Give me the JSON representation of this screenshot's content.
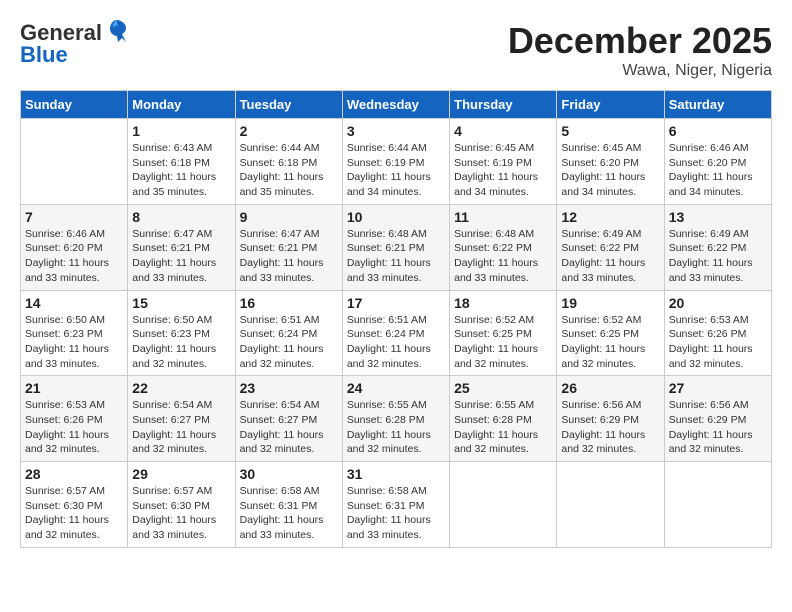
{
  "logo": {
    "general": "General",
    "blue": "Blue"
  },
  "title": "December 2025",
  "location": "Wawa, Niger, Nigeria",
  "days_of_week": [
    "Sunday",
    "Monday",
    "Tuesday",
    "Wednesday",
    "Thursday",
    "Friday",
    "Saturday"
  ],
  "weeks": [
    [
      {
        "num": "",
        "sunrise": "",
        "sunset": "",
        "daylight": ""
      },
      {
        "num": "1",
        "sunrise": "Sunrise: 6:43 AM",
        "sunset": "Sunset: 6:18 PM",
        "daylight": "Daylight: 11 hours and 35 minutes."
      },
      {
        "num": "2",
        "sunrise": "Sunrise: 6:44 AM",
        "sunset": "Sunset: 6:18 PM",
        "daylight": "Daylight: 11 hours and 35 minutes."
      },
      {
        "num": "3",
        "sunrise": "Sunrise: 6:44 AM",
        "sunset": "Sunset: 6:19 PM",
        "daylight": "Daylight: 11 hours and 34 minutes."
      },
      {
        "num": "4",
        "sunrise": "Sunrise: 6:45 AM",
        "sunset": "Sunset: 6:19 PM",
        "daylight": "Daylight: 11 hours and 34 minutes."
      },
      {
        "num": "5",
        "sunrise": "Sunrise: 6:45 AM",
        "sunset": "Sunset: 6:20 PM",
        "daylight": "Daylight: 11 hours and 34 minutes."
      },
      {
        "num": "6",
        "sunrise": "Sunrise: 6:46 AM",
        "sunset": "Sunset: 6:20 PM",
        "daylight": "Daylight: 11 hours and 34 minutes."
      }
    ],
    [
      {
        "num": "7",
        "sunrise": "Sunrise: 6:46 AM",
        "sunset": "Sunset: 6:20 PM",
        "daylight": "Daylight: 11 hours and 33 minutes."
      },
      {
        "num": "8",
        "sunrise": "Sunrise: 6:47 AM",
        "sunset": "Sunset: 6:21 PM",
        "daylight": "Daylight: 11 hours and 33 minutes."
      },
      {
        "num": "9",
        "sunrise": "Sunrise: 6:47 AM",
        "sunset": "Sunset: 6:21 PM",
        "daylight": "Daylight: 11 hours and 33 minutes."
      },
      {
        "num": "10",
        "sunrise": "Sunrise: 6:48 AM",
        "sunset": "Sunset: 6:21 PM",
        "daylight": "Daylight: 11 hours and 33 minutes."
      },
      {
        "num": "11",
        "sunrise": "Sunrise: 6:48 AM",
        "sunset": "Sunset: 6:22 PM",
        "daylight": "Daylight: 11 hours and 33 minutes."
      },
      {
        "num": "12",
        "sunrise": "Sunrise: 6:49 AM",
        "sunset": "Sunset: 6:22 PM",
        "daylight": "Daylight: 11 hours and 33 minutes."
      },
      {
        "num": "13",
        "sunrise": "Sunrise: 6:49 AM",
        "sunset": "Sunset: 6:22 PM",
        "daylight": "Daylight: 11 hours and 33 minutes."
      }
    ],
    [
      {
        "num": "14",
        "sunrise": "Sunrise: 6:50 AM",
        "sunset": "Sunset: 6:23 PM",
        "daylight": "Daylight: 11 hours and 33 minutes."
      },
      {
        "num": "15",
        "sunrise": "Sunrise: 6:50 AM",
        "sunset": "Sunset: 6:23 PM",
        "daylight": "Daylight: 11 hours and 32 minutes."
      },
      {
        "num": "16",
        "sunrise": "Sunrise: 6:51 AM",
        "sunset": "Sunset: 6:24 PM",
        "daylight": "Daylight: 11 hours and 32 minutes."
      },
      {
        "num": "17",
        "sunrise": "Sunrise: 6:51 AM",
        "sunset": "Sunset: 6:24 PM",
        "daylight": "Daylight: 11 hours and 32 minutes."
      },
      {
        "num": "18",
        "sunrise": "Sunrise: 6:52 AM",
        "sunset": "Sunset: 6:25 PM",
        "daylight": "Daylight: 11 hours and 32 minutes."
      },
      {
        "num": "19",
        "sunrise": "Sunrise: 6:52 AM",
        "sunset": "Sunset: 6:25 PM",
        "daylight": "Daylight: 11 hours and 32 minutes."
      },
      {
        "num": "20",
        "sunrise": "Sunrise: 6:53 AM",
        "sunset": "Sunset: 6:26 PM",
        "daylight": "Daylight: 11 hours and 32 minutes."
      }
    ],
    [
      {
        "num": "21",
        "sunrise": "Sunrise: 6:53 AM",
        "sunset": "Sunset: 6:26 PM",
        "daylight": "Daylight: 11 hours and 32 minutes."
      },
      {
        "num": "22",
        "sunrise": "Sunrise: 6:54 AM",
        "sunset": "Sunset: 6:27 PM",
        "daylight": "Daylight: 11 hours and 32 minutes."
      },
      {
        "num": "23",
        "sunrise": "Sunrise: 6:54 AM",
        "sunset": "Sunset: 6:27 PM",
        "daylight": "Daylight: 11 hours and 32 minutes."
      },
      {
        "num": "24",
        "sunrise": "Sunrise: 6:55 AM",
        "sunset": "Sunset: 6:28 PM",
        "daylight": "Daylight: 11 hours and 32 minutes."
      },
      {
        "num": "25",
        "sunrise": "Sunrise: 6:55 AM",
        "sunset": "Sunset: 6:28 PM",
        "daylight": "Daylight: 11 hours and 32 minutes."
      },
      {
        "num": "26",
        "sunrise": "Sunrise: 6:56 AM",
        "sunset": "Sunset: 6:29 PM",
        "daylight": "Daylight: 11 hours and 32 minutes."
      },
      {
        "num": "27",
        "sunrise": "Sunrise: 6:56 AM",
        "sunset": "Sunset: 6:29 PM",
        "daylight": "Daylight: 11 hours and 32 minutes."
      }
    ],
    [
      {
        "num": "28",
        "sunrise": "Sunrise: 6:57 AM",
        "sunset": "Sunset: 6:30 PM",
        "daylight": "Daylight: 11 hours and 32 minutes."
      },
      {
        "num": "29",
        "sunrise": "Sunrise: 6:57 AM",
        "sunset": "Sunset: 6:30 PM",
        "daylight": "Daylight: 11 hours and 33 minutes."
      },
      {
        "num": "30",
        "sunrise": "Sunrise: 6:58 AM",
        "sunset": "Sunset: 6:31 PM",
        "daylight": "Daylight: 11 hours and 33 minutes."
      },
      {
        "num": "31",
        "sunrise": "Sunrise: 6:58 AM",
        "sunset": "Sunset: 6:31 PM",
        "daylight": "Daylight: 11 hours and 33 minutes."
      },
      {
        "num": "",
        "sunrise": "",
        "sunset": "",
        "daylight": ""
      },
      {
        "num": "",
        "sunrise": "",
        "sunset": "",
        "daylight": ""
      },
      {
        "num": "",
        "sunrise": "",
        "sunset": "",
        "daylight": ""
      }
    ]
  ]
}
